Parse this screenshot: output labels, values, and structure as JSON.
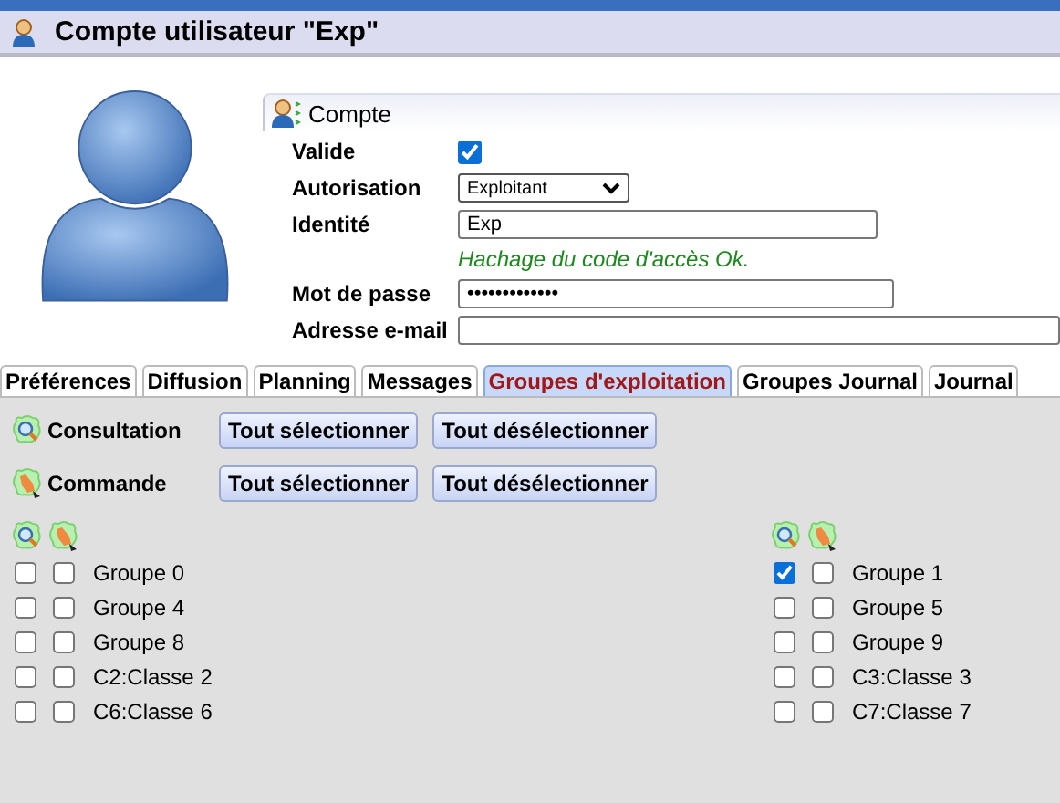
{
  "header": {
    "title": "Compte utilisateur \"Exp\""
  },
  "account": {
    "legend": "Compte",
    "fields": [
      {
        "kind": "checkbox",
        "label": "Valide",
        "checked": true
      },
      {
        "kind": "select",
        "label": "Autorisation",
        "value": "Exploitant"
      },
      {
        "kind": "text",
        "label": "Identité",
        "value": "Exp",
        "note": "Hachage du code d'accès Ok."
      },
      {
        "kind": "text",
        "label": "Mot de passe",
        "value": "•••••••••••••"
      },
      {
        "kind": "text",
        "label": "Adresse e-mail"
      }
    ]
  },
  "tabs": [
    {
      "label": "Préférences",
      "selected": false
    },
    {
      "label": "Diffusion",
      "selected": false
    },
    {
      "label": "Planning",
      "selected": false
    },
    {
      "label": "Messages",
      "selected": false
    },
    {
      "label": "Groupes d'exploitation",
      "selected": true
    },
    {
      "label": "Groupes Journal",
      "selected": false
    },
    {
      "label": "Journal",
      "selected": false
    }
  ],
  "actions": [
    {
      "kind": "consultation",
      "label": "Consultation",
      "buttons": [
        "Tout sélectionner",
        "Tout désélectionner"
      ]
    },
    {
      "kind": "commande",
      "label": "Commande",
      "buttons": [
        "Tout sélectionner",
        "Tout désélectionner"
      ]
    }
  ],
  "columns": [
    {
      "groups": [
        {
          "label": "Groupe 0",
          "consultation": false,
          "commande": false
        },
        {
          "label": "Groupe 4",
          "consultation": false,
          "commande": false
        },
        {
          "label": "Groupe 8",
          "consultation": false,
          "commande": false
        },
        {
          "label": "C2:Classe 2",
          "consultation": false,
          "commande": false
        },
        {
          "label": "C6:Classe 6",
          "consultation": false,
          "commande": false
        }
      ]
    },
    {
      "groups": [
        {
          "label": "Groupe 1",
          "consultation": true,
          "commande": false
        },
        {
          "label": "Groupe 5",
          "consultation": false,
          "commande": false
        },
        {
          "label": "Groupe 9",
          "consultation": false,
          "commande": false
        },
        {
          "label": "C3:Classe 3",
          "consultation": false,
          "commande": false
        },
        {
          "label": "C7:Classe 7",
          "consultation": false,
          "commande": false
        }
      ]
    }
  ]
}
